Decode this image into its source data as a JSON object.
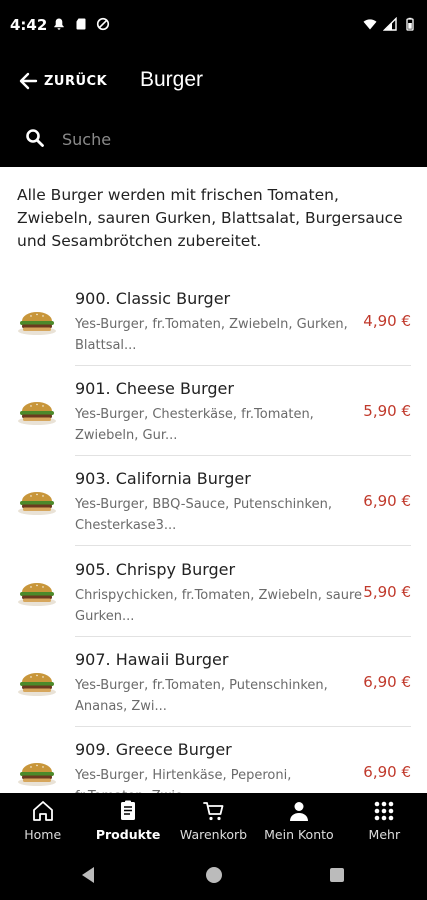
{
  "status_bar": {
    "time": "4:42"
  },
  "header": {
    "back_label": "ZURÜCK",
    "title": "Burger"
  },
  "search": {
    "placeholder": "Suche"
  },
  "intro_text": "Alle Burger werden mit frischen Tomaten, Zwiebeln, sauren Gurken, Blattsalat, Burgersauce und Sesambrötchen zubereitet.",
  "items": [
    {
      "name": "900. Classic Burger",
      "desc": "Yes-Burger, fr.Tomaten, Zwiebeln, Gurken, Blattsal...",
      "price": "4,90 €"
    },
    {
      "name": "901. Cheese Burger",
      "desc": "Yes-Burger, Chesterkäse, fr.Tomaten, Zwiebeln, Gur...",
      "price": "5,90 €"
    },
    {
      "name": "903. California Burger",
      "desc": "Yes-Burger, BBQ-Sauce, Putenschinken, Chesterkase3...",
      "price": "6,90 €"
    },
    {
      "name": "905. Chrispy Burger",
      "desc": "Chrispychicken, fr.Tomaten, Zwiebeln, saure Gurken...",
      "price": "5,90 €"
    },
    {
      "name": "907. Hawaii Burger",
      "desc": "Yes-Burger, fr.Tomaten, Putenschinken, Ananas, Zwi...",
      "price": "6,90 €"
    },
    {
      "name": "909. Greece Burger",
      "desc": "Yes-Burger, Hirtenkäse, Peperoni, fr.Tomaten, Zwie...",
      "price": "6,90 €"
    }
  ],
  "bottom_nav": {
    "home": "Home",
    "produkte": "Produkte",
    "warenkorb": "Warenkorb",
    "mein_konto": "Mein Konto",
    "mehr": "Mehr",
    "active": "produkte"
  },
  "colors": {
    "price": "#c0392b",
    "bar": "#000000"
  }
}
